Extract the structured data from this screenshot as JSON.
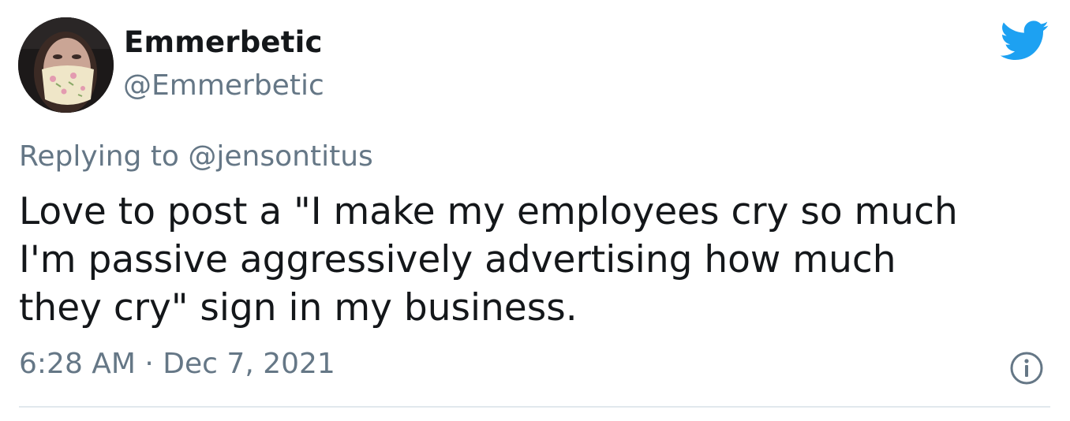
{
  "author": {
    "display_name": "Emmerbetic",
    "handle": "@Emmerbetic",
    "avatar": "profile-photo-masked-woman"
  },
  "header": {
    "brand_icon": "twitter-bird-icon",
    "brand_color": "#1da1f2"
  },
  "tweet": {
    "replying_to": "Replying to @jensontitus",
    "text": "Love to post a \"I make my employees cry so much\nI'm passive aggressively advertising how much\nthey cry\" sign in my business.",
    "timestamp": "6:28 AM · Dec 7, 2021",
    "info_icon": "info-icon"
  },
  "colors": {
    "text_primary": "#14171a",
    "text_secondary": "#657786",
    "divider": "#e1e8ed"
  }
}
